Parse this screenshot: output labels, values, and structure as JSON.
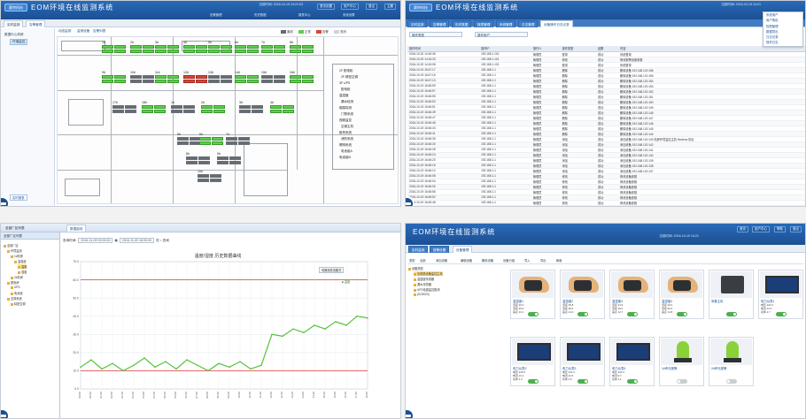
{
  "colors": {
    "header_blue": "#1b4f93",
    "device_green": "#5ccf4c",
    "device_gray": "#666b71",
    "device_red": "#d9453a",
    "limit_red": "#e05555",
    "series_green": "#55c23c"
  },
  "app": {
    "title": "EOM环境在线监测系统",
    "logo": "赛特科技"
  },
  "p1": {
    "clock": "当前时间: 2016-10-19 14:21:03",
    "buttons": [
      "首页设置",
      "用户中心",
      "退出",
      "主题"
    ],
    "menus": [
      "告警管理",
      "历史数据",
      "报表中心",
      "系统设置"
    ],
    "tabs": [
      "实时监测",
      "告警管理"
    ],
    "left_items": [
      "数据中心机房",
      "环境监控"
    ],
    "left_bottom": "实时报表",
    "subtabs": [
      "动态监测",
      "监测设备",
      "告警列表"
    ],
    "legend": [
      "离线",
      "正常",
      "告警",
      "关闭"
    ],
    "racks": [
      "1#",
      "2#",
      "3#",
      "4#",
      "5#",
      "6#",
      "7#",
      "8#",
      "9#",
      "10#",
      "11#",
      "12#",
      "13#",
      "14#",
      "15#",
      "16#",
      "17#",
      "18#"
    ],
    "right_labels": [
      "1F 配电柜",
      "2F 精密空调",
      "3F UPS",
      "配电柜",
      "温湿度",
      "漏水检测",
      "烟感探测",
      "门禁系统",
      "视频监控",
      "空调主机",
      "新风系统",
      "消防系统",
      "照明系统",
      "电池组A",
      "电池组B"
    ]
  },
  "p2": {
    "clock": "当前时间: 2016-10-19 14:21",
    "tabs": [
      "实时监测",
      "告警管理",
      "历史数据",
      "报表管理",
      "系统管理",
      "日志管理",
      "设备操作日志记录"
    ],
    "filters": [
      "操作类型",
      "操作用户"
    ],
    "menu": [
      "系统用户",
      "用户角色",
      "权限管理",
      "数据导出",
      "日志记录",
      "操作日志"
    ],
    "columns": [
      "操作时间",
      "操作IP",
      "操作人",
      "操作类型",
      "结果",
      "内容"
    ],
    "rows": [
      [
        "2016-10-20 14:16:36",
        "192.168.1.101",
        "管理员",
        "登录",
        "成功",
        "系统登录"
      ],
      [
        "2016-10-20 14:16:33",
        "192.168.1.101",
        "管理员",
        "修改",
        "成功",
        "修改报警设置参数"
      ],
      [
        "2016-10-20 14:15:08",
        "192.168.1.101",
        "管理员",
        "登录",
        "成功",
        "系统登录"
      ],
      [
        "2016-10-19 16:47:17",
        "192.168.1.1",
        "管理员",
        "删除",
        "成功",
        "删除设备 192.168.120.156"
      ],
      [
        "2016-10-19 16:47:15",
        "192.168.1.1",
        "管理员",
        "删除",
        "成功",
        "删除设备 192.168.120.155"
      ],
      [
        "2016-10-19 16:47:13",
        "192.168.1.1",
        "管理员",
        "删除",
        "成功",
        "删除设备 192.168.120.154"
      ],
      [
        "2016-10-19 16:46:59",
        "192.168.1.1",
        "管理员",
        "删除",
        "成功",
        "删除设备 192.168.120.153"
      ],
      [
        "2016-10-19 16:46:57",
        "192.168.1.1",
        "管理员",
        "删除",
        "成功",
        "删除设备 192.168.120.152"
      ],
      [
        "2016-10-19 16:46:55",
        "192.168.1.1",
        "管理员",
        "删除",
        "成功",
        "删除设备 192.168.120.151"
      ],
      [
        "2016-10-19 16:46:53",
        "192.168.1.1",
        "管理员",
        "删除",
        "成功",
        "删除设备 192.168.120.150"
      ],
      [
        "2016-10-19 16:46:51",
        "192.168.1.1",
        "管理员",
        "删除",
        "成功",
        "删除设备 192.168.120.149"
      ],
      [
        "2016-10-19 16:46:49",
        "192.168.1.1",
        "管理员",
        "删除",
        "成功",
        "删除设备 192.168.120.148"
      ],
      [
        "2016-10-19 16:46:47",
        "192.168.1.1",
        "管理员",
        "删除",
        "成功",
        "删除设备 192.168.120.147"
      ],
      [
        "2016-10-19 16:46:45",
        "192.168.1.1",
        "管理员",
        "删除",
        "成功",
        "删除设备 192.168.120.146"
      ],
      [
        "2016-10-19 16:46:43",
        "192.168.1.1",
        "管理员",
        "删除",
        "成功",
        "删除设备 192.168.120.145"
      ],
      [
        "2016-10-19 16:46:41",
        "192.168.1.1",
        "管理员",
        "删除",
        "成功",
        "删除设备 192.168.120.144"
      ],
      [
        "2016-10-19 16:46:35",
        "192.168.1.1",
        "管理员",
        "添加",
        "成功",
        "添加设备 192.168.120.143 机房环境监控主机 Modbus 协议"
      ],
      [
        "2016-10-19 16:46:30",
        "192.168.1.1",
        "管理员",
        "添加",
        "成功",
        "添加设备 192.168.120.142"
      ],
      [
        "2016-10-19 16:46:28",
        "192.168.1.1",
        "管理员",
        "添加",
        "成功",
        "添加设备 192.168.120.141"
      ],
      [
        "2016-10-19 16:46:24",
        "192.168.1.1",
        "管理员",
        "添加",
        "成功",
        "添加设备 192.168.120.140"
      ],
      [
        "2016-10-19 16:46:20",
        "192.168.1.1",
        "管理员",
        "添加",
        "成功",
        "添加设备 192.168.120.139"
      ],
      [
        "2016-10-19 16:46:16",
        "192.168.1.1",
        "管理员",
        "添加",
        "成功",
        "添加设备 192.168.120.138"
      ],
      [
        "2016-10-19 16:46:12",
        "192.168.1.1",
        "管理员",
        "添加",
        "成功",
        "添加设备 192.168.120.137"
      ],
      [
        "2016-10-19 16:46:08",
        "192.168.1.1",
        "管理员",
        "修改",
        "成功",
        "修改设备参数"
      ],
      [
        "2016-10-19 16:46:04",
        "192.168.1.1",
        "管理员",
        "修改",
        "成功",
        "修改设备参数"
      ],
      [
        "2016-10-19 16:46:00",
        "192.168.1.1",
        "管理员",
        "修改",
        "成功",
        "修改设备参数"
      ],
      [
        "2016-10-19 16:45:56",
        "192.168.1.1",
        "管理员",
        "修改",
        "成功",
        "修改设备参数"
      ],
      [
        "2016-10-19 16:45:52",
        "192.168.1.1",
        "管理员",
        "修改",
        "成功",
        "修改设备参数"
      ],
      [
        "2016-10-19 16:45:48",
        "192.168.1.1",
        "管理员",
        "修改",
        "成功",
        "修改设备参数"
      ]
    ]
  },
  "p3": {
    "header_left": "全部厂区列表",
    "header_tab": "数据曲线",
    "tree": [
      "全部厂区",
      "环境监测",
      "1#机房",
      "温湿度",
      "温度",
      "湿度",
      "2#机房",
      "配电房",
      "UPS",
      "电池组",
      "空调系统",
      "精密空调"
    ],
    "query_label": "查询时间:",
    "query_from": "2016-11-09 00:00:00",
    "query_to": "2016-11-09 18:00:00",
    "query_btn": "查询",
    "chart_title": "温度/湿度 历史数据曲线",
    "chart_btn": "切换到总览模式",
    "chart_legend": "■ 温度",
    "ylabels": [
      "70.0",
      "60.0",
      "50.0",
      "40.0",
      "30.0",
      "20.0",
      "10.0",
      "0.0"
    ]
  },
  "chart_data": {
    "type": "line",
    "title": "温度/湿度 历史数据曲线",
    "ylim": [
      0,
      70
    ],
    "limit_line": 60,
    "lower_line": 10,
    "x": [
      "00:00",
      "00:40",
      "01:20",
      "02:00",
      "02:40",
      "03:20",
      "04:00",
      "04:40",
      "05:20",
      "06:00",
      "06:40",
      "07:20",
      "08:00",
      "08:40",
      "09:20",
      "10:00",
      "10:40",
      "11:20",
      "12:00",
      "12:40",
      "13:20",
      "14:00",
      "14:40",
      "15:20",
      "16:00",
      "16:40",
      "17:20",
      "18:00"
    ],
    "series": [
      {
        "values": [
          12,
          16,
          11,
          14,
          10,
          13,
          17,
          12,
          15,
          11,
          16,
          13,
          10,
          14,
          12,
          15,
          11,
          13,
          30,
          29,
          33,
          31,
          35,
          33,
          37,
          35,
          40,
          39
        ]
      }
    ]
  },
  "p4": {
    "clock": "当前时间: 2016-10-19 14:21",
    "buttons": [
      "首页",
      "用户中心",
      "帮助",
      "退出"
    ],
    "tabs": [
      "实时监测",
      "报警设置"
    ],
    "subtab": "设备管理",
    "toolbar": [
      "类型",
      "全部",
      "添加设备",
      "编辑设备",
      "删除设备",
      "设备分组",
      "导入",
      "导出",
      "刷新"
    ],
    "tree": [
      "设备类型",
      "空调类设备监控主机",
      "温湿度传感器",
      "漏水传感器",
      "UPS电源监控模块",
      "(SC5020)"
    ],
    "cards": [
      {
        "name": "温湿度1",
        "lines": [
          "温度 26.3",
          "湿度 45.0",
          "露点 13.1"
        ],
        "on": true,
        "kind": "hand"
      },
      {
        "name": "温湿度2",
        "lines": [
          "温度 25.8",
          "湿度 48.0",
          "露点 14.0"
        ],
        "on": true,
        "kind": "hand"
      },
      {
        "name": "温湿度3",
        "lines": [
          "温度 24.9",
          "湿度 46.0",
          "露点 12.7"
        ],
        "on": true,
        "kind": "hand"
      },
      {
        "name": "温湿度4",
        "lines": [
          "温度 26.0",
          "湿度 50.0",
          "露点 14.8"
        ],
        "on": true,
        "kind": "hand"
      },
      {
        "name": "采集主机",
        "lines": [],
        "on": true,
        "kind": "box"
      },
      {
        "name": "电力仪表1",
        "lines": [
          "电压 220.0",
          "电流 12.3",
          "功率 2.7"
        ],
        "on": true,
        "kind": "meter"
      },
      {
        "name": "电力仪表2",
        "lines": [
          "电压 219.5",
          "电流 10.1",
          "功率 2.2"
        ],
        "on": true,
        "kind": "meter"
      },
      {
        "name": "电力仪表3",
        "lines": [
          "电压 221.0",
          "电流 11.8",
          "功率 2.6"
        ],
        "on": true,
        "kind": "meter"
      },
      {
        "name": "电力仪表4",
        "lines": [
          "电压 220.4",
          "电流 9.7",
          "功率 2.1"
        ],
        "on": true,
        "kind": "meter"
      },
      {
        "name": "1#声光报警",
        "lines": [],
        "on": false,
        "kind": "light"
      },
      {
        "name": "2#声光报警",
        "lines": [],
        "on": false,
        "kind": "light"
      }
    ]
  }
}
